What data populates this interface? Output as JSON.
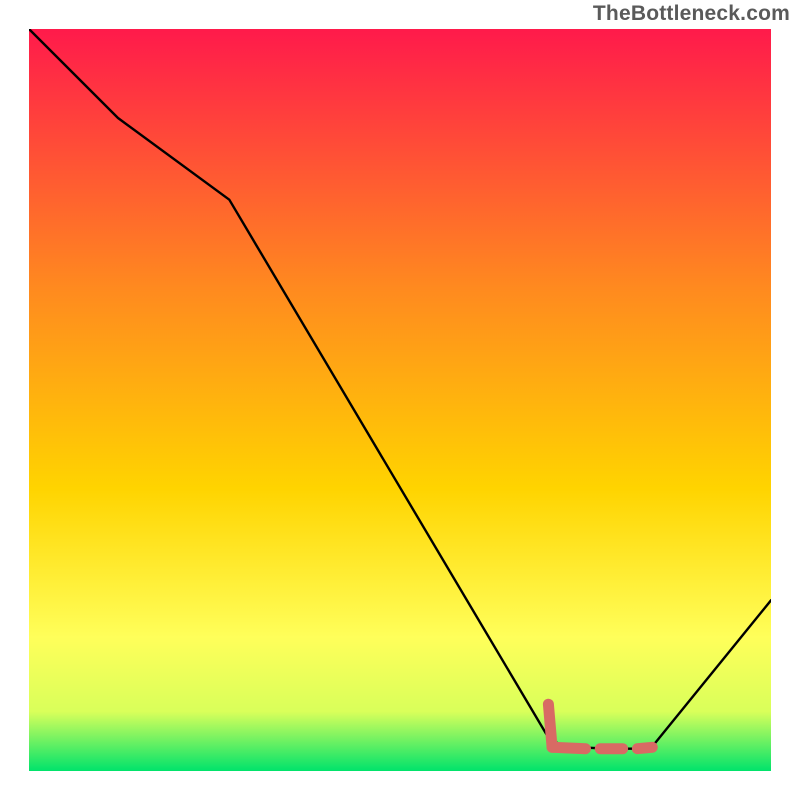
{
  "watermark": "TheBottleneck.com",
  "colors": {
    "gradient_top": "#ff1a4b",
    "gradient_mid1": "#ff6a1f",
    "gradient_mid2": "#ffd400",
    "gradient_mid3": "#ffff5a",
    "gradient_mid4": "#d9ff5a",
    "gradient_bottom": "#00e36b",
    "line": "#000000",
    "marker": "#d86a64"
  },
  "chart_data": {
    "type": "line",
    "title": "",
    "xlabel": "",
    "ylabel": "",
    "xlim": [
      0,
      100
    ],
    "ylim": [
      0,
      100
    ],
    "grid": false,
    "legend_position": "none",
    "series": [
      {
        "name": "bottleneck-curve",
        "x": [
          0,
          12,
          27,
          70,
          72,
          78,
          82,
          84,
          100
        ],
        "y": [
          100,
          88,
          77,
          4.5,
          3.3,
          3.0,
          3.0,
          3.3,
          23
        ]
      }
    ],
    "markers": [
      {
        "name": "optimal-L-segment-vert",
        "segment": {
          "x1": 70,
          "y1": 9,
          "x2": 70.5,
          "y2": 3.2
        }
      },
      {
        "name": "optimal-L-segment-horz",
        "segment": {
          "x1": 70.5,
          "y1": 3.2,
          "x2": 75,
          "y2": 3.0
        }
      },
      {
        "name": "optimal-dash-1",
        "segment": {
          "x1": 77,
          "y1": 3.0,
          "x2": 80,
          "y2": 3.0
        }
      },
      {
        "name": "optimal-dash-2",
        "segment": {
          "x1": 82,
          "y1": 3.0,
          "x2": 84,
          "y2": 3.2
        }
      }
    ],
    "annotations": []
  }
}
